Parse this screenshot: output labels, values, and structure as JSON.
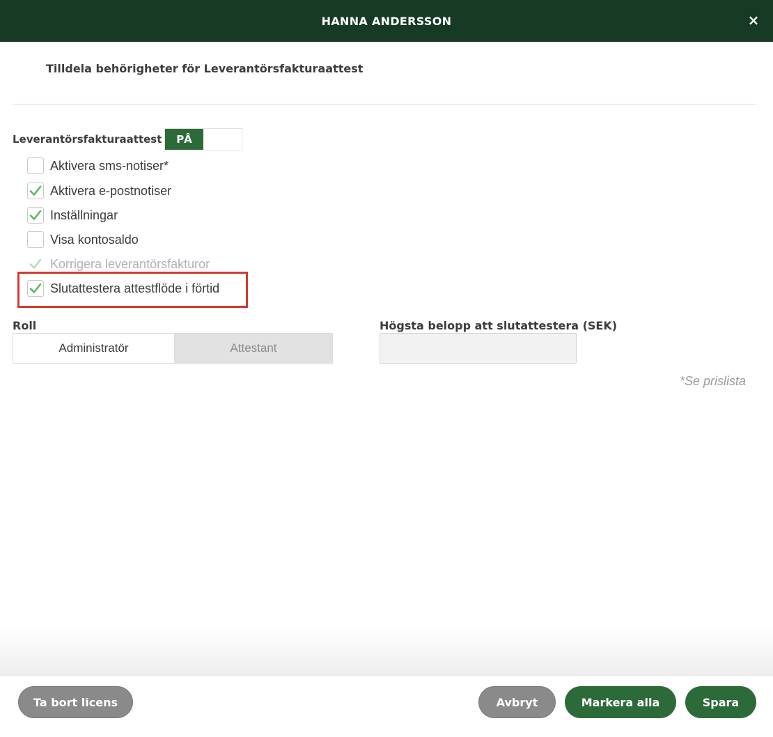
{
  "header": {
    "title": "HANNA ANDERSSON",
    "close_symbol": "×"
  },
  "subtitle": "Tilldela behörigheter för Leverantörsfakturaattest",
  "module": {
    "label": "Leverantörsfakturaattest",
    "toggle_on_label": "PÅ",
    "toggle_state": "on"
  },
  "options": [
    {
      "label": "Aktivera sms-notiser*",
      "checked": false,
      "disabled": false
    },
    {
      "label": "Aktivera e-postnotiser",
      "checked": true,
      "disabled": false
    },
    {
      "label": "Inställningar",
      "checked": true,
      "disabled": false
    },
    {
      "label": "Visa kontosaldo",
      "checked": false,
      "disabled": false
    },
    {
      "label": "Korrigera leverantörsfakturor",
      "checked": true,
      "disabled": true
    },
    {
      "label": "Slutattestera attestflöde i förtid",
      "checked": true,
      "disabled": false
    }
  ],
  "role": {
    "label": "Roll",
    "options": [
      "Administratör",
      "Attestant"
    ],
    "selected": "Administratör"
  },
  "amount": {
    "label": "Högsta belopp att slutattestera (SEK)",
    "value": ""
  },
  "price_note": "*Se prislista",
  "footer": {
    "remove_license": "Ta bort licens",
    "cancel": "Avbryt",
    "mark_all": "Markera alla",
    "save": "Spara"
  },
  "colors": {
    "header_bg": "#163a24",
    "primary_green": "#2d6a39",
    "check_green": "#5cb85c",
    "secondary_gray": "#8a8a8a",
    "highlight_red": "#d23b2f"
  }
}
